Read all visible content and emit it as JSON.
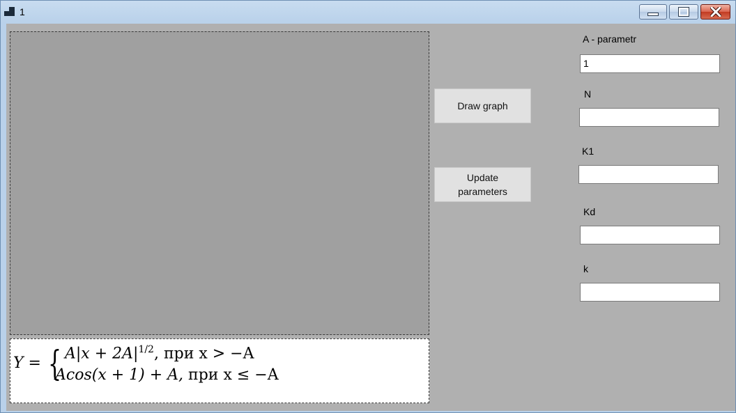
{
  "window": {
    "title": "1",
    "icon": "app-window-icon",
    "controls": [
      "minimize-icon",
      "maximize-icon",
      "close-icon"
    ]
  },
  "formula": {
    "lhs": "Y =",
    "case1_expr": "A|x + 2A|",
    "case1_exp": "1/2",
    "case1_cond": ",  при x > −A",
    "case2_expr": "Acos(x + 1) + A,",
    "case2_cond": " при x ≤ −A"
  },
  "buttons": {
    "draw": "Draw graph",
    "update_line1": "Update",
    "update_line2": "parameters"
  },
  "params": {
    "a_label": "A - parametr",
    "a_value": "1",
    "n_label": "N",
    "n_value": "",
    "k1_label": "K1",
    "k1_value": "",
    "kd_label": "Kd",
    "kd_value": "",
    "k_label": "k",
    "k_value": ""
  },
  "colors": {
    "client_bg": "#b0b0b0",
    "picture_bg": "#a0a0a0",
    "close_button": "#c23b22"
  }
}
